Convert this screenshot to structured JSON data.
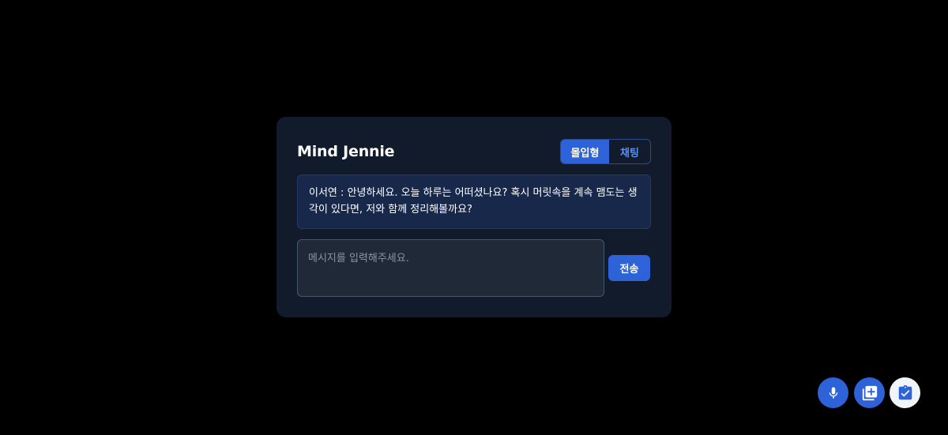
{
  "card": {
    "title": "Mind Jennie",
    "modes": [
      {
        "label": "몰입형",
        "active": true
      },
      {
        "label": "채팅",
        "active": false
      }
    ],
    "message": "이서연 : 안녕하세요. 오늘 하루는 어떠셨나요? 혹시 머릿속을 계속 맴도는 생각이 있다면, 저와 함께 정리해볼까요?",
    "input": {
      "value": "",
      "placeholder": "메시지를 입력해주세요."
    },
    "send_label": "전송"
  },
  "fabs": [
    {
      "icon": "microphone-icon",
      "color": "#2d62d8"
    },
    {
      "icon": "add-to-library-icon",
      "color": "#2d62d8"
    },
    {
      "icon": "clipboard-check-icon",
      "color": "#f1f4f9"
    }
  ],
  "colors": {
    "background": "#000000",
    "card": "#121b2c",
    "accent": "#2d62d8",
    "message_bg": "#17284a"
  }
}
